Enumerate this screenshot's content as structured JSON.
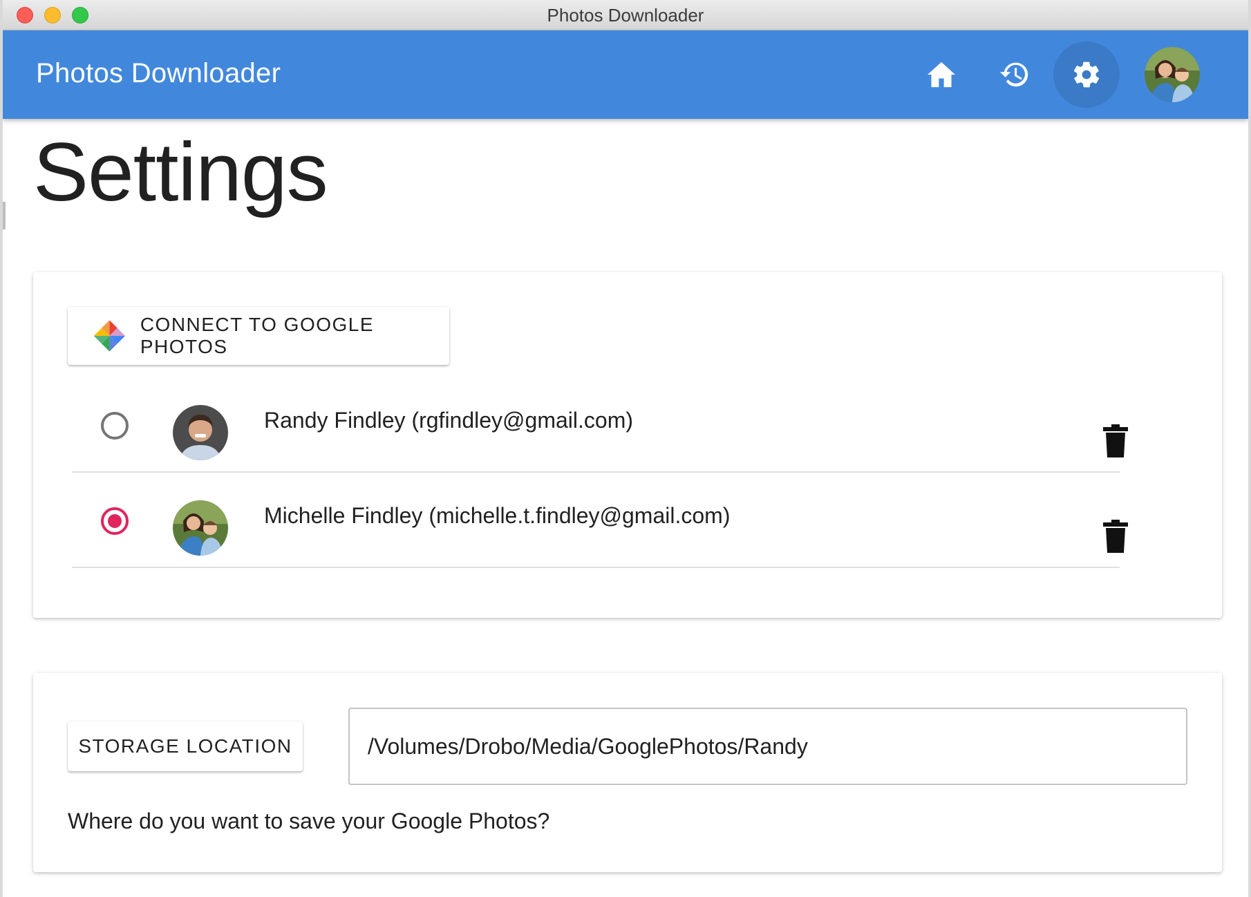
{
  "window": {
    "title": "Photos Downloader"
  },
  "appbar": {
    "title": "Photos Downloader",
    "color": "#4188dd",
    "nav": [
      {
        "icon": "home-icon",
        "active": false
      },
      {
        "icon": "history-icon",
        "active": false
      },
      {
        "icon": "gear-icon",
        "active": true
      }
    ],
    "avatar": "user-avatar"
  },
  "page": {
    "title": "Settings"
  },
  "accounts_card": {
    "connect_label": "CONNECT TO GOOGLE PHOTOS",
    "accounts": [
      {
        "name": "Randy Findley (rgfindley@gmail.com)",
        "selected": false
      },
      {
        "name": "Michelle Findley (michelle.t.findley@gmail.com)",
        "selected": true
      }
    ]
  },
  "storage_card": {
    "button_label": "STORAGE LOCATION",
    "path": "/Volumes/Drobo/Media/GooglePhotos/Randy",
    "hint": "Where do you want to save your Google Photos?"
  },
  "colors": {
    "accent": "#e0245e",
    "appbar": "#4188dd"
  }
}
